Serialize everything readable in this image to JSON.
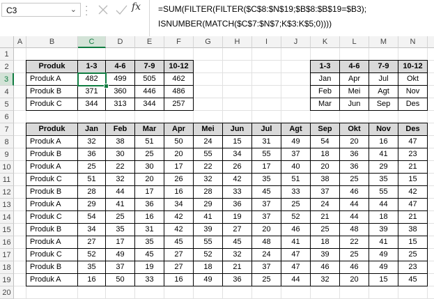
{
  "namebox": {
    "value": "C3"
  },
  "formula": {
    "line1": "=SUM(FILTER(FILTER($C$8:$N$19;$B$8:$B$19=$B3);",
    "line2": "ISNUMBER(MATCH($C$7:$N$7;K$3:K$5;0))))"
  },
  "columns": [
    "A",
    "B",
    "C",
    "D",
    "E",
    "F",
    "G",
    "H",
    "I",
    "J",
    "K",
    "L",
    "M",
    "N"
  ],
  "rows": [
    "1",
    "2",
    "3",
    "4",
    "5",
    "6",
    "7",
    "8",
    "9",
    "10",
    "11",
    "12",
    "13",
    "14",
    "15",
    "16",
    "17",
    "18",
    "19",
    "20"
  ],
  "selected_cell": "C3",
  "summary": {
    "headers": [
      "Produk",
      "1-3",
      "4-6",
      "7-9",
      "10-12"
    ],
    "rows": [
      [
        "Produk A",
        "482",
        "499",
        "505",
        "462"
      ],
      [
        "Produk B",
        "371",
        "360",
        "446",
        "486"
      ],
      [
        "Produk C",
        "344",
        "313",
        "344",
        "257"
      ]
    ]
  },
  "quarters": {
    "headers": [
      "1-3",
      "4-6",
      "7-9",
      "10-12"
    ],
    "rows": [
      [
        "Jan",
        "Apr",
        "Jul",
        "Okt"
      ],
      [
        "Feb",
        "Mei",
        "Agt",
        "Nov"
      ],
      [
        "Mar",
        "Jun",
        "Sep",
        "Des"
      ]
    ]
  },
  "sales": {
    "headers": [
      "Produk",
      "Jan",
      "Feb",
      "Mar",
      "Apr",
      "Mei",
      "Jun",
      "Jul",
      "Agt",
      "Sep",
      "Okt",
      "Nov",
      "Des"
    ],
    "rows": [
      [
        "Produk A",
        "32",
        "38",
        "51",
        "50",
        "24",
        "15",
        "31",
        "49",
        "54",
        "20",
        "16",
        "47"
      ],
      [
        "Produk B",
        "36",
        "30",
        "25",
        "20",
        "55",
        "34",
        "55",
        "37",
        "18",
        "36",
        "41",
        "23"
      ],
      [
        "Produk A",
        "25",
        "22",
        "30",
        "17",
        "22",
        "26",
        "17",
        "40",
        "20",
        "36",
        "29",
        "21"
      ],
      [
        "Produk C",
        "51",
        "32",
        "20",
        "26",
        "32",
        "42",
        "35",
        "51",
        "38",
        "25",
        "35",
        "15"
      ],
      [
        "Produk B",
        "28",
        "44",
        "17",
        "16",
        "28",
        "33",
        "45",
        "33",
        "37",
        "46",
        "55",
        "42"
      ],
      [
        "Produk A",
        "29",
        "41",
        "36",
        "34",
        "29",
        "36",
        "37",
        "25",
        "24",
        "44",
        "44",
        "47"
      ],
      [
        "Produk C",
        "54",
        "25",
        "16",
        "42",
        "41",
        "19",
        "37",
        "52",
        "21",
        "44",
        "18",
        "21"
      ],
      [
        "Produk B",
        "34",
        "35",
        "31",
        "42",
        "39",
        "27",
        "20",
        "46",
        "25",
        "48",
        "39",
        "38"
      ],
      [
        "Produk A",
        "27",
        "17",
        "35",
        "45",
        "55",
        "45",
        "48",
        "41",
        "18",
        "22",
        "41",
        "15"
      ],
      [
        "Produk C",
        "52",
        "49",
        "45",
        "27",
        "52",
        "32",
        "24",
        "47",
        "39",
        "25",
        "49",
        "25"
      ],
      [
        "Produk B",
        "35",
        "37",
        "19",
        "27",
        "18",
        "21",
        "37",
        "47",
        "46",
        "46",
        "49",
        "23"
      ],
      [
        "Produk A",
        "16",
        "50",
        "33",
        "16",
        "49",
        "36",
        "25",
        "44",
        "32",
        "20",
        "15",
        "45"
      ]
    ]
  }
}
